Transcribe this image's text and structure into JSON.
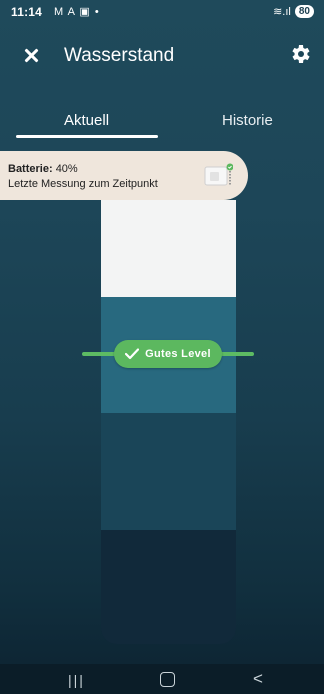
{
  "status_bar": {
    "time": "11:14",
    "icons": "M A ▣ •",
    "wifi": "≋.ıl",
    "battery": "80"
  },
  "app_bar": {
    "title": "Wasserstand"
  },
  "tabs": [
    {
      "label": "Aktuell",
      "active": true
    },
    {
      "label": "Historie",
      "active": false
    }
  ],
  "info_card": {
    "battery_label": "Batterie:",
    "battery_value": "40%",
    "measurement_text": "Letzte Messung zum Zeitpunkt"
  },
  "level": {
    "label": "Gutes Level",
    "status_color": "#5cb85f"
  },
  "colors": {
    "accent_green": "#5cb85f",
    "background": "#1d4658"
  },
  "nav_bar": {
    "recent": "|||",
    "back": "<"
  }
}
